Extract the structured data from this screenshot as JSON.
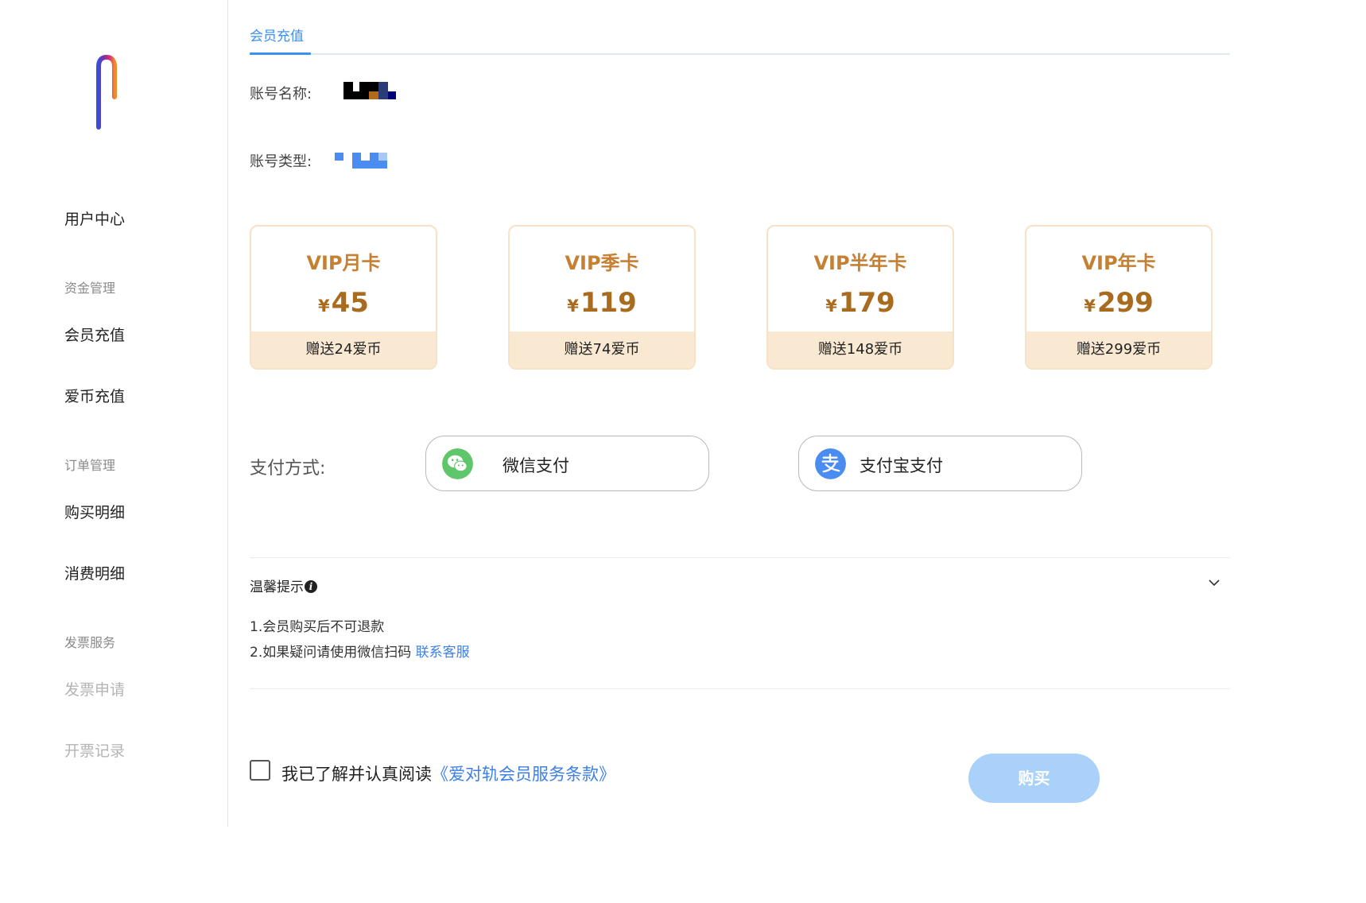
{
  "sidebar": {
    "items": [
      {
        "label": "用户中心"
      },
      {
        "group": "资金管理"
      },
      {
        "label": "会员充值"
      },
      {
        "label": "爱币充值"
      },
      {
        "group": "订单管理"
      },
      {
        "label": "购买明细"
      },
      {
        "label": "消费明细"
      },
      {
        "group": "发票服务"
      },
      {
        "label": "发票申请",
        "disabled": true
      },
      {
        "label": "开票记录",
        "disabled": true
      }
    ]
  },
  "tabs": [
    {
      "label": "会员充值",
      "active": true
    }
  ],
  "account": {
    "name_label": "账号名称:",
    "type_label": "账号类型:"
  },
  "plans": [
    {
      "name": "VIP月卡",
      "currency": "¥",
      "price": "45",
      "bonus": "赠送24爱币"
    },
    {
      "name": "VIP季卡",
      "currency": "¥",
      "price": "119",
      "bonus": "赠送74爱币"
    },
    {
      "name": "VIP半年卡",
      "currency": "¥",
      "price": "179",
      "bonus": "赠送148爱币"
    },
    {
      "name": "VIP年卡",
      "currency": "¥",
      "price": "299",
      "bonus": "赠送299爱币"
    }
  ],
  "payment": {
    "label": "支付方式:",
    "methods": [
      {
        "label": "微信支付",
        "icon": "wechat-pay-icon",
        "color": "#5fc66b"
      },
      {
        "label": "支付宝支付",
        "icon": "alipay-icon",
        "color": "#4a8cf0"
      }
    ]
  },
  "tips": {
    "title": "温馨提示",
    "lines": [
      "1.会员购买后不可退款",
      "2.如果疑问请使用微信扫码"
    ],
    "contact_link": "联系客服"
  },
  "agreement": {
    "text": "我已了解并认真阅读",
    "link": "《爱对轨会员服务条款》",
    "checked": false
  },
  "buy_button": "购买",
  "colors": {
    "accent": "#3d8ff0",
    "plan_title": "#c58033",
    "plan_price": "#a96c1e",
    "plan_footer": "#f9e8d2",
    "buy_button": "#a9d1f9"
  }
}
